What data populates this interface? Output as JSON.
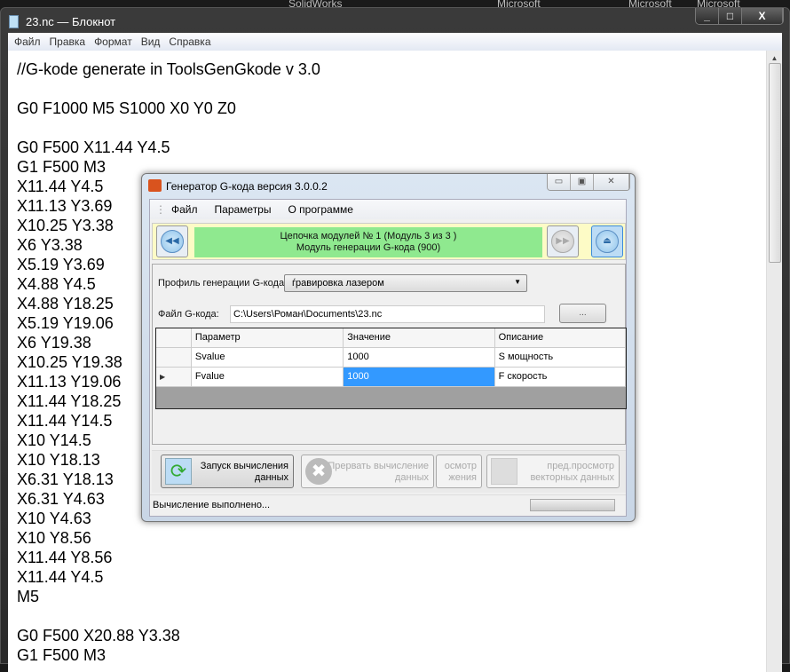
{
  "taskbar": {
    "items": [
      "SolidWorks",
      "Microsoft",
      "Microsoft",
      "Microsoft"
    ]
  },
  "notepad": {
    "title": "23.nc — Блокнот",
    "controls": [
      "_",
      "□",
      "X"
    ],
    "menu": [
      "Файл",
      "Правка",
      "Формат",
      "Вид",
      "Справка"
    ],
    "text": "//G-kode generate in ToolsGenGkode v 3.0\n\nG0 F1000 M5 S1000 X0 Y0 Z0\n\nG0 F500 X11.44 Y4.5\nG1 F500 M3\nX11.44 Y4.5\nX11.13 Y3.69\nX10.25 Y3.38\nX6 Y3.38\nX5.19 Y3.69\nX4.88 Y4.5\nX4.88 Y18.25\nX5.19 Y19.06\nX6 Y19.38\nX10.25 Y19.38\nX11.13 Y19.06\nX11.44 Y18.25\nX11.44 Y14.5\nX10 Y14.5\nX10 Y18.13\nX6.31 Y18.13\nX6.31 Y4.63\nX10 Y4.63\nX10 Y8.56\nX11.44 Y8.56\nX11.44 Y4.5\nM5\n\nG0 F500 X20.88 Y3.38\nG1 F500 M3"
  },
  "dialog": {
    "title": "Генератор G-кода версия 3.0.0.2",
    "menu": [
      "Файл",
      "Параметры",
      "О программе"
    ],
    "chain": {
      "line1": "Цепочка модулей № 1 (Модуль 3 из 3 )",
      "line2": "Модуль генерации G-кода (900)"
    },
    "profile_label": "Профиль генерации G-кода:",
    "profile_value": "ѓравировка лазером",
    "file_label": "Файл G-кода:",
    "file_value": "C:\\Users\\Роман\\Documents\\23.nc",
    "browse": "...",
    "grid": {
      "headers": [
        "Параметр",
        "Значение",
        "Описание"
      ],
      "rows": [
        [
          "Svalue",
          "1000",
          "S мощность"
        ],
        [
          "Fvalue",
          "1000",
          "F скорость"
        ]
      ]
    },
    "buttons": {
      "run": [
        "Запуск вычисления",
        "данных"
      ],
      "stop": [
        "Прервать вычисление",
        "данных"
      ],
      "preview_img": [
        "осмотр",
        "жения"
      ],
      "preview_vec": [
        "пред.просмотр",
        "векторных данных"
      ]
    },
    "status": "Вычисление выполнено..."
  }
}
